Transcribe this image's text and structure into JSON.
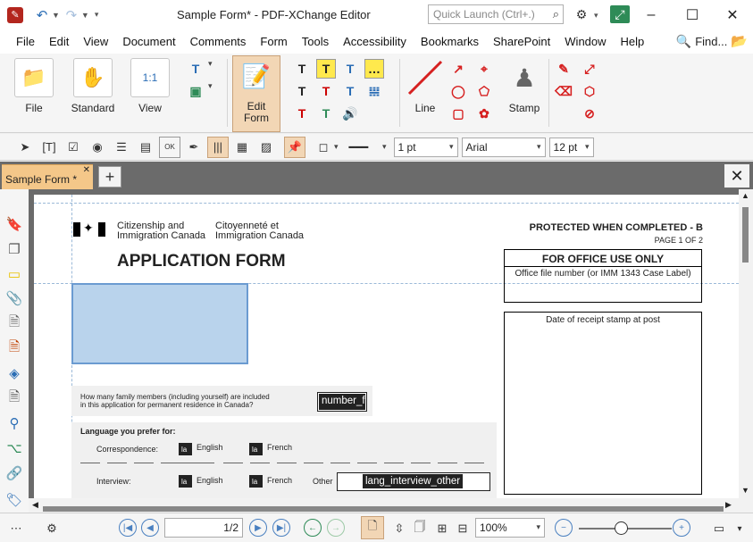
{
  "titlebar": {
    "title": "Sample Form* - PDF-XChange Editor",
    "quick_launch_placeholder": "Quick Launch (Ctrl+.)"
  },
  "menu": {
    "items": [
      "File",
      "Edit",
      "View",
      "Document",
      "Comments",
      "Form",
      "Tools",
      "Accessibility",
      "Bookmarks",
      "SharePoint",
      "Window",
      "Help"
    ],
    "find_label": "Find..."
  },
  "ribbon": {
    "file_label": "File",
    "standard_label": "Standard",
    "view_label": "View",
    "edit_form_label_1": "Edit",
    "edit_form_label_2": "Form",
    "line_label": "Line",
    "stamp_label": "Stamp"
  },
  "toolbar2": {
    "line_width": "1 pt",
    "font": "Arial",
    "font_size": "12 pt"
  },
  "tabs": {
    "doc_tab_label": "Sample Form *"
  },
  "document": {
    "dept_en_1": "Citizenship and",
    "dept_en_2": "Immigration Canada",
    "dept_fr_1": "Citoyenneté et",
    "dept_fr_2": "Immigration Canada",
    "form_title": "APPLICATION FORM",
    "protected": "PROTECTED WHEN COMPLETED - B",
    "page_of": "PAGE 1 OF 2",
    "office_use": "FOR OFFICE USE ONLY",
    "office_file": "Office file number (or IMM 1343 Case Label)",
    "receipt_stamp": "Date of receipt stamp at post",
    "family_q_1": "How many family members (including yourself) are included",
    "family_q_2": "in this application for permanent residence in Canada?",
    "family_field": "number_f",
    "lang_title": "Language you prefer for:",
    "correspondence": "Correspondence:",
    "interview": "Interview:",
    "english": "English",
    "french": "French",
    "other": "Other",
    "cb_label": "la",
    "lang_other_field": "lang_interview_other"
  },
  "status": {
    "page_value": "1",
    "page_total": "/2",
    "zoom": "100%"
  }
}
